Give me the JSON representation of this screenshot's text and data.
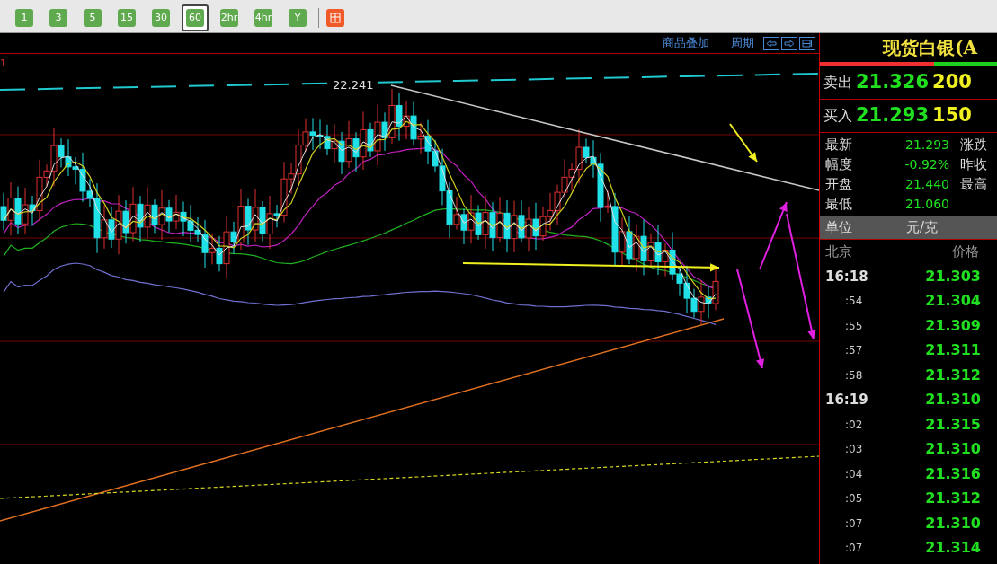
{
  "toolbar": {
    "periods": [
      {
        "label": "1",
        "selected": false
      },
      {
        "label": "3",
        "selected": false
      },
      {
        "label": "5",
        "selected": false
      },
      {
        "label": "15",
        "selected": false
      },
      {
        "label": "30",
        "selected": false
      },
      {
        "label": "60",
        "selected": true
      },
      {
        "label": "2hr",
        "selected": false
      },
      {
        "label": "4hr",
        "selected": false
      },
      {
        "label": "Y",
        "selected": false
      }
    ]
  },
  "chart": {
    "links": [
      "商品叠加",
      "周期"
    ],
    "pane_label": "1",
    "peak_label": "22.241"
  },
  "quote": {
    "title": "现货白银(A",
    "bid_ask": [
      {
        "label": "卖出",
        "price": "21.326",
        "volume": "200"
      },
      {
        "label": "买入",
        "price": "21.293",
        "volume": "150"
      }
    ],
    "stats": [
      {
        "label": "最新",
        "value": "21.293",
        "label_2": "涨跌"
      },
      {
        "label": "幅度",
        "value": "-0.92%",
        "label_2": "昨收"
      },
      {
        "label": "开盘",
        "value": "21.440",
        "label_2": "最高"
      },
      {
        "label": "最低",
        "value": "21.060"
      }
    ],
    "unit": {
      "label": "单位",
      "value": "元/克"
    },
    "ticks_header": {
      "time": "北京",
      "price": "价格"
    },
    "ticks": [
      {
        "kind": "hour",
        "time": "16:18",
        "price": "21.303"
      },
      {
        "kind": "second",
        "time": ":54",
        "price": "21.304"
      },
      {
        "kind": "second",
        "time": ":55",
        "price": "21.309"
      },
      {
        "kind": "second",
        "time": ":57",
        "price": "21.311"
      },
      {
        "kind": "second",
        "time": ":58",
        "price": "21.312"
      },
      {
        "kind": "hour",
        "time": "16:19",
        "price": "21.310"
      },
      {
        "kind": "second",
        "time": ":02",
        "price": "21.315"
      },
      {
        "kind": "second",
        "time": ":03",
        "price": "21.310"
      },
      {
        "kind": "second",
        "time": ":04",
        "price": "21.316"
      },
      {
        "kind": "second",
        "time": ":05",
        "price": "21.312"
      },
      {
        "kind": "second",
        "time": ":07",
        "price": "21.310"
      },
      {
        "kind": "second",
        "time": ":07",
        "price": "21.314"
      }
    ]
  }
}
